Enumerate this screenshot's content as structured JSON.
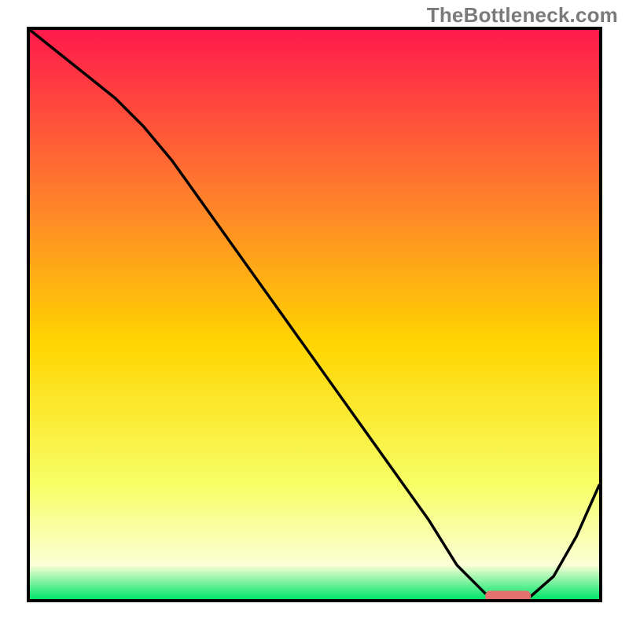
{
  "watermark": "TheBottleneck.com",
  "colors": {
    "gradient_top": "#ff1a4b",
    "gradient_q1": "#ff7a2e",
    "gradient_mid": "#ffd500",
    "gradient_q3": "#f7ff66",
    "gradient_low": "#fbffd6",
    "gradient_bottom": "#00e56a",
    "curve": "#000000",
    "marker": "#e4716f",
    "border": "#000000"
  },
  "chart_data": {
    "type": "line",
    "title": "",
    "xlabel": "",
    "ylabel": "",
    "xlim": [
      0,
      100
    ],
    "ylim": [
      0,
      100
    ],
    "grid": false,
    "legend": false,
    "series": [
      {
        "name": "bottleneck-curve",
        "x": [
          0,
          5,
          10,
          15,
          20,
          25,
          30,
          35,
          40,
          45,
          50,
          55,
          60,
          65,
          70,
          75,
          80,
          83,
          88,
          92,
          96,
          100
        ],
        "values": [
          100,
          96,
          92,
          88,
          83,
          77,
          70,
          63,
          56,
          49,
          42,
          35,
          28,
          21,
          14,
          6,
          1,
          0.5,
          0.5,
          4,
          11,
          20
        ]
      }
    ],
    "annotations": [
      {
        "name": "optimal-marker",
        "x_start": 80,
        "x_end": 88,
        "y": 0.5
      }
    ]
  }
}
